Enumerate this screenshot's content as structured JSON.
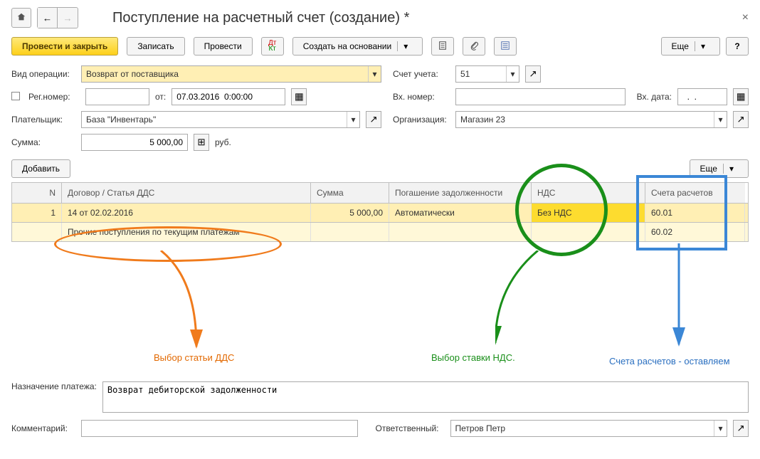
{
  "header": {
    "title": "Поступление на расчетный счет (создание) *"
  },
  "toolbar": {
    "post_close": "Провести и закрыть",
    "write": "Записать",
    "post": "Провести",
    "create_from": "Создать на основании",
    "more": "Еще",
    "help": "?"
  },
  "fields": {
    "operation_type_label": "Вид операции:",
    "operation_type_value": "Возврат от поставщика",
    "account_label": "Счет учета:",
    "account_value": "51",
    "reg_number_label": "Рег.номер:",
    "reg_number_value": "",
    "from_label": "от:",
    "from_value": "07.03.2016  0:00:00",
    "incoming_number_label": "Вх. номер:",
    "incoming_number_value": "",
    "incoming_date_label": "Вх. дата:",
    "incoming_date_value": "  .  .    ",
    "payer_label": "Плательщик:",
    "payer_value": "База \"Инвентарь\"",
    "org_label": "Организация:",
    "org_value": "Магазин 23",
    "sum_label": "Сумма:",
    "sum_value": "5 000,00",
    "currency": "руб.",
    "purpose_label": "Назначение платежа:",
    "purpose_value": "Возврат дебиторской задолженности",
    "comment_label": "Комментарий:",
    "comment_value": "",
    "responsible_label": "Ответственный:",
    "responsible_value": "Петров Петр"
  },
  "table": {
    "add": "Добавить",
    "more": "Еще",
    "headers": {
      "n": "N",
      "contract": "Договор / Статья ДДС",
      "sum": "Сумма",
      "debt": "Погашение задолженности",
      "vat": "НДС",
      "accounts": "Счета расчетов"
    },
    "row1": {
      "n": "1",
      "contract": "14 от 02.02.2016",
      "sum": "5 000,00",
      "debt": "Автоматически",
      "vat": "Без НДС",
      "account": "60.01"
    },
    "row2": {
      "contract": "Прочие поступления по текущим платежам",
      "account": "60.02"
    }
  },
  "annotations": {
    "dds": "Выбор статьи ДДС",
    "vat": "Выбор ставки НДС.",
    "accounts": "Счета расчетов - оставляем"
  }
}
